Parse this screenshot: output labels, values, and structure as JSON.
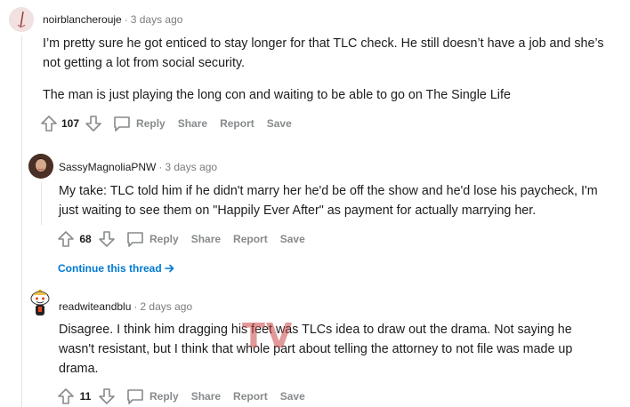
{
  "comments": [
    {
      "username": "noirblancherouje",
      "time": "3 days ago",
      "paragraphs": [
        "I’m pretty sure he got enticed to stay longer for that TLC check. He still doesn’t have a job and she’s",
        "not getting a lot from social security.",
        "The man is just playing the long con and waiting to be able to go on The Single Life"
      ],
      "score": "107",
      "actions": {
        "reply": "Reply",
        "share": "Share",
        "report": "Report",
        "save": "Save"
      }
    },
    {
      "username": "SassyMagnoliaPNW",
      "time": "3 days ago",
      "paragraphs": [
        "My take: TLC told him if he didn't marry her he'd be off the show and he'd lose his paycheck, I'm",
        "just waiting to see them on \"Happily Ever After\" as payment for actually marrying her."
      ],
      "score": "68",
      "actions": {
        "reply": "Reply",
        "share": "Share",
        "report": "Report",
        "save": "Save"
      }
    },
    {
      "username": "readwiteandblu",
      "time": "2 days ago",
      "paragraphs": [
        "Disagree. I think him dragging his feet was TLCs idea to draw out the drama. Not saying he",
        "wasn't resistant, but I think that whole part about telling the attorney to not file was made up",
        "drama."
      ],
      "score": "11",
      "actions": {
        "reply": "Reply",
        "share": "Share",
        "report": "Report",
        "save": "Save"
      }
    }
  ],
  "continue_thread": "Continue this thread",
  "watermark": "TV",
  "colors": {
    "meta": "#7c7c7c",
    "action": "#878a8c",
    "link": "#0079d3"
  },
  "icons": {
    "upvote": "upvote-arrow-icon",
    "downvote": "downvote-arrow-icon",
    "reply": "comment-bubble-icon",
    "continue": "arrow-right-icon"
  }
}
